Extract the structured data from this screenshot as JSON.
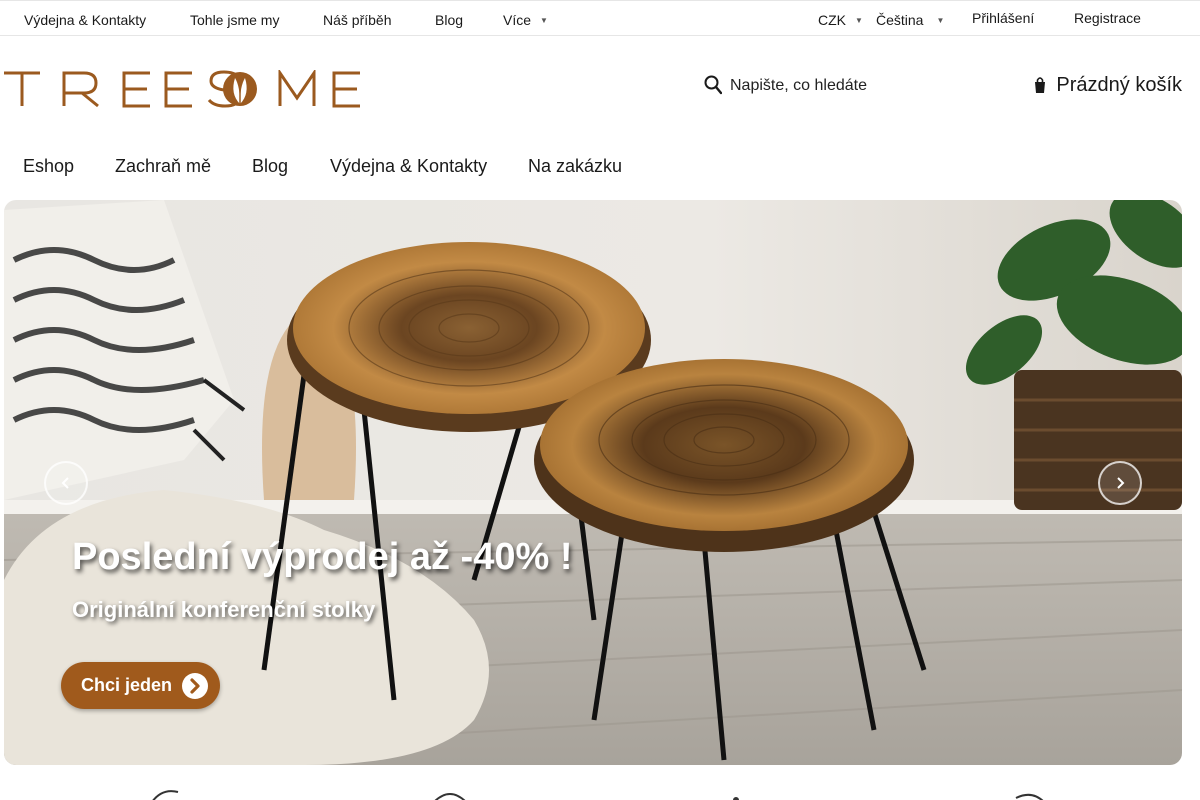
{
  "topbar": {
    "links": [
      "Výdejna & Kontakty",
      "Tohle jsme my",
      "Náš příběh",
      "Blog"
    ],
    "more_label": "Více",
    "currency": "CZK",
    "language": "Čeština",
    "login": "Přihlášení",
    "register": "Registrace"
  },
  "header": {
    "logo_text": "TREESOME",
    "search_placeholder": "Napište, co hledáte",
    "cart_label": "Prázdný košík"
  },
  "nav": {
    "items": [
      "Eshop",
      "Zachraň mě",
      "Blog",
      "Výdejna & Kontakty",
      "Na zakázku"
    ]
  },
  "hero": {
    "title": "Poslední výprodej až -40% !",
    "subtitle": "Originální konferenční stolky",
    "cta_label": "Chci jeden"
  },
  "colors": {
    "brand_brown": "#a05a1c",
    "logo_brown": "#9b5a1f"
  },
  "icons": [
    "search-icon",
    "cart-icon",
    "chevron-left-icon",
    "chevron-right-icon",
    "chevron-circle-right-icon"
  ]
}
